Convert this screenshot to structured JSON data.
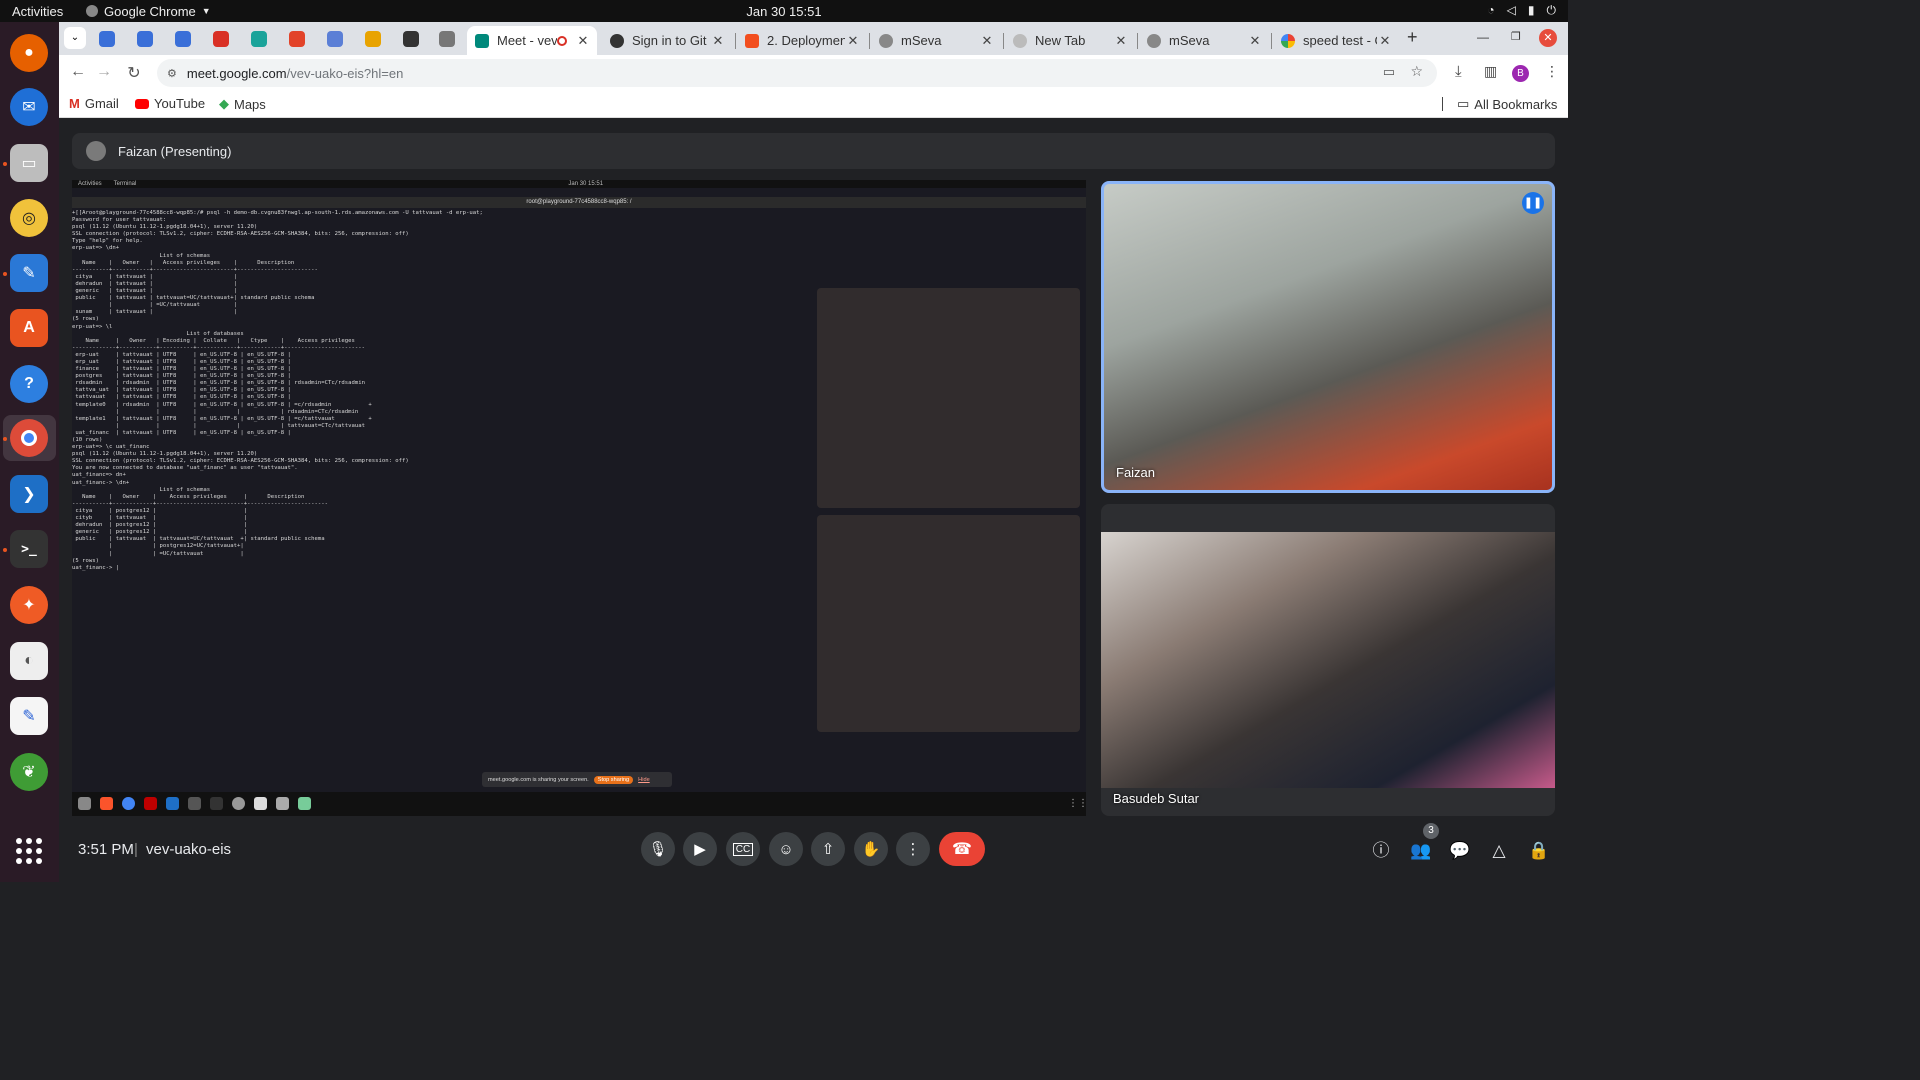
{
  "os": {
    "activities": "Activities",
    "app_name": "Google Chrome",
    "clock": "Jan 30  15:51"
  },
  "browser": {
    "tabs": [
      {
        "label": "Meet - vev",
        "active": true
      },
      {
        "label": "Sign in to Git"
      },
      {
        "label": "2. Deploymen"
      },
      {
        "label": "mSeva"
      },
      {
        "label": "New Tab"
      },
      {
        "label": "mSeva"
      },
      {
        "label": "speed test - G"
      }
    ],
    "new_tab": "+",
    "url_host": "meet.google.com",
    "url_path": "/vev-uako-eis?hl=en",
    "profile_initial": "B",
    "bookmarks": [
      {
        "label": "Gmail"
      },
      {
        "label": "YouTube"
      },
      {
        "label": "Maps"
      }
    ],
    "all_bookmarks": "All Bookmarks"
  },
  "meet": {
    "presenter_label": "Faizan (Presenting)",
    "participants": [
      {
        "name": "Faizan"
      },
      {
        "name": "Basudeb Sutar"
      }
    ],
    "time": "3:51 PM",
    "separator": "|",
    "meeting_code": "vev-uako-eis",
    "participant_count": "3"
  },
  "shared_screen": {
    "activities": "Activities",
    "terminal": "Terminal",
    "clock": "Jan 30 15:51",
    "window_title": "root@playground-77c4588cc8-wqp85: /",
    "terminal_lines": [
      "+[[Aroot@playground-77c4588cc8-wqp85:/# psql -h demo-db.cvgnu83fnwgl.ap-south-1.rds.amazonaws.com -U tattvauat -d erp-uat;",
      "Password for user tattvauat:",
      "psql (11.12 (Ubuntu 11.12-1.pgdg18.04+1), server 11.20)",
      "SSL connection (protocol: TLSv1.2, cipher: ECDHE-RSA-AES256-GCM-SHA384, bits: 256, compression: off)",
      "Type \"help\" for help.",
      "",
      "erp-uat=> \\dn+",
      "                          List of schemas",
      "   Name    |   Owner   |   Access privileges    |      Description",
      "-----------+-----------+------------------------+------------------------",
      " citya     | tattvauat |                        |",
      " dehradun  | tattvauat |                        |",
      " generic   | tattvauat |                        |",
      " public    | tattvauat | tattvauat=UC/tattvauat+| standard public schema",
      "           |           | =UC/tattvauat          |",
      " sunam     | tattvauat |                        |",
      "(5 rows)",
      "",
      "erp-uat=> \\l",
      "                                  List of databases",
      "    Name     |   Owner   | Encoding |  Collate   |   Ctype    |    Access privileges",
      "-------------+-----------+----------+------------+------------+------------------------",
      " erp-uat     | tattvauat | UTF8     | en_US.UTF-8 | en_US.UTF-8 |",
      " erp_uat     | tattvauat | UTF8     | en_US.UTF-8 | en_US.UTF-8 |",
      " finance     | tattvauat | UTF8     | en_US.UTF-8 | en_US.UTF-8 |",
      " postgres    | tattvauat | UTF8     | en_US.UTF-8 | en_US.UTF-8 |",
      " rdsadmin    | rdsadmin  | UTF8     | en_US.UTF-8 | en_US.UTF-8 | rdsadmin=CTc/rdsadmin",
      " tattva_uat  | tattvauat | UTF8     | en_US.UTF-8 | en_US.UTF-8 |",
      " tattvauat   | tattvauat | UTF8     | en_US.UTF-8 | en_US.UTF-8 |",
      " template0   | rdsadmin  | UTF8     | en_US.UTF-8 | en_US.UTF-8 | =c/rdsadmin           +",
      "             |           |          |            |            | rdsadmin=CTc/rdsadmin",
      " template1   | tattvauat | UTF8     | en_US.UTF-8 | en_US.UTF-8 | =c/tattvauat          +",
      "             |           |          |            |            | tattvauat=CTc/tattvauat",
      " uat_financ  | tattvauat | UTF8     | en_US.UTF-8 | en_US.UTF-8 |",
      "(10 rows)",
      "",
      "erp-uat=> \\c uat_financ",
      "psql (11.12 (Ubuntu 11.12-1.pgdg18.04+1), server 11.20)",
      "SSL connection (protocol: TLSv1.2, cipher: ECDHE-RSA-AES256-GCM-SHA384, bits: 256, compression: off)",
      "You are now connected to database \"uat_financ\" as user \"tattvauat\".",
      "uat_financ=> dn+",
      "uat_financ-> \\dn+",
      "                          List of schemas",
      "   Name    |   Owner    |    Access privileges     |      Description",
      "-----------+------------+--------------------------+------------------------",
      " citya     | postgres12 |                          |",
      " cityb     | tattvauat  |                          |",
      " dehradun  | postgres12 |                          |",
      " generic   | postgres12 |                          |",
      " public    | tattvauat  | tattvauat=UC/tattvauat  +| standard public schema",
      "           |            | postgres12=UC/tattvauat+|",
      "           |            | =UC/tattvauat           |",
      "(5 rows)",
      "",
      "uat_financ-> |"
    ],
    "share_notice": "meet.google.com is sharing your screen.",
    "stop_sharing": "Stop sharing",
    "hide": "Hide"
  }
}
